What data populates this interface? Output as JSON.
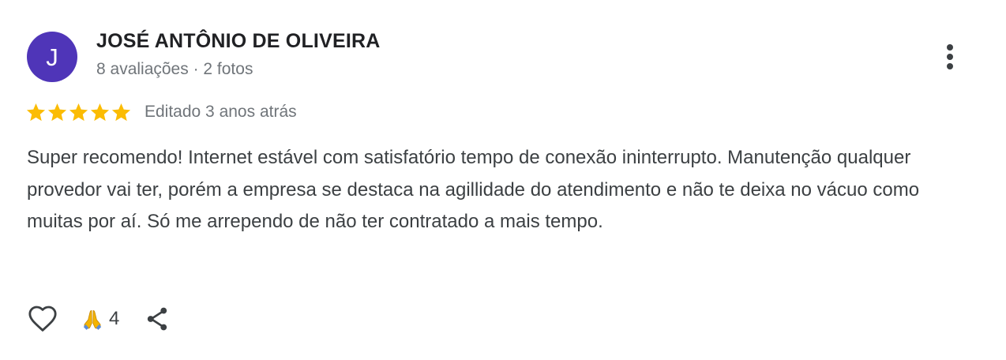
{
  "review": {
    "author": {
      "initial": "J",
      "name": "JOSÉ ANTÔNIO DE OLIVEIRA",
      "meta": "8 avaliações · 2 fotos",
      "avatar_color": "#4f35b8"
    },
    "rating": {
      "stars": 5,
      "max_stars": 5,
      "star_color": "#fbbc04",
      "edited_label": "Editado 3 anos atrás"
    },
    "text": "Super recomendo! Internet estável com satisfatório tempo de conexão ininterrupto. Manutenção qualquer provedor vai ter, porém a empresa se destaca na agillidade do atendimento e não te deixa no vácuo como muitas por aí. Só me arrependo de não ter contratado a mais tempo.",
    "actions": {
      "like_icon": "heart-outline-icon",
      "reaction_icon": "folded-hands-emoji-icon",
      "reaction_count": "4",
      "share_icon": "share-icon"
    },
    "menu_icon": "more-vertical-icon"
  }
}
